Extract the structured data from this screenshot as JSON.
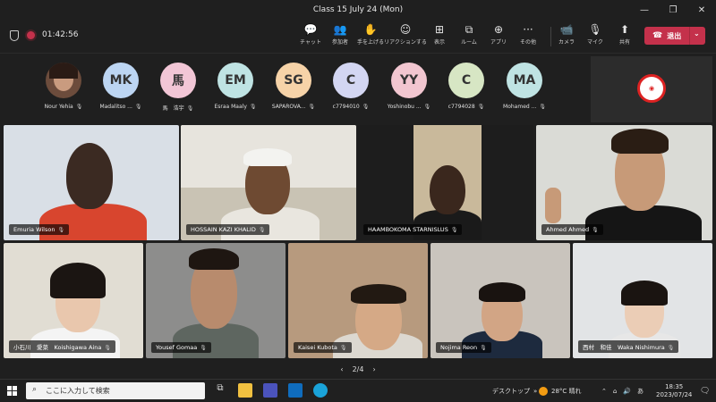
{
  "window": {
    "title": "Class 15 July 24 (Mon)",
    "controls": [
      "—",
      "❐",
      "✕"
    ]
  },
  "meeting": {
    "timer": "01:42:56"
  },
  "toolbar": {
    "buttons": [
      {
        "label": "チャット",
        "icon": "chat-icon",
        "glyph": "💬"
      },
      {
        "label": "参加者",
        "icon": "people-icon",
        "glyph": "👥"
      },
      {
        "label": "手を上げる",
        "icon": "raise-hand-icon",
        "glyph": "✋"
      },
      {
        "label": "リアクションする",
        "icon": "reaction-icon",
        "glyph": "☺"
      },
      {
        "label": "表示",
        "icon": "view-icon",
        "glyph": "⊞"
      },
      {
        "label": "ルーム",
        "icon": "rooms-icon",
        "glyph": "⧉"
      },
      {
        "label": "アプリ",
        "icon": "apps-icon",
        "glyph": "⊕"
      },
      {
        "label": "その他",
        "icon": "more-icon",
        "glyph": "···"
      },
      {
        "label": "カメラ",
        "icon": "camera-icon",
        "glyph": "📹"
      },
      {
        "label": "マイク",
        "icon": "mic-icon",
        "glyph": "🎙"
      },
      {
        "label": "共有",
        "icon": "share-icon",
        "glyph": "⬆"
      }
    ],
    "leave_label": "退出"
  },
  "attendees": [
    {
      "initials": "",
      "name": "Nour Yehia",
      "color": "#7a5a48",
      "photo": true
    },
    {
      "initials": "MK",
      "name": "Madalitso ...",
      "color": "#bcd5f2"
    },
    {
      "initials": "馬",
      "name": "馬　浩宇",
      "color": "#f2c6d6"
    },
    {
      "initials": "EM",
      "name": "Esraa Maaly",
      "color": "#bfe3e3"
    },
    {
      "initials": "SG",
      "name": "SAPAROVA...",
      "color": "#f6d3a8"
    },
    {
      "initials": "C",
      "name": "c7794010",
      "color": "#d3d6f2"
    },
    {
      "initials": "YY",
      "name": "Yoshinobu ...",
      "color": "#f2c6d0"
    },
    {
      "initials": "C",
      "name": "c7794028",
      "color": "#d7e6c4"
    },
    {
      "initials": "MA",
      "name": "Mohamed ...",
      "color": "#bfe3e3"
    }
  ],
  "videos": [
    {
      "name": "Emuria Wilson",
      "bg": "#d9dfe6",
      "skin": "#3b2a22",
      "shirt": "#d8452e",
      "hair": "#1e1511"
    },
    {
      "name": "HOSSAIN KAZI KHALID",
      "bg": "#c9c3b4",
      "skin": "#6e4a32",
      "shirt": "#e9e6df",
      "hair": "#f3f3f0"
    },
    {
      "name": "HAAMBOKOMA STARNISLUS",
      "bg": "#1d1d1d",
      "skin": "#3a271d",
      "shirt": "#1a1a1a",
      "hair": "#1a1410"
    },
    {
      "name": "Ahmed Ahmed",
      "bg": "#dadbd6",
      "skin": "#c79a78",
      "shirt": "#151515",
      "hair": "#2a1d14"
    },
    {
      "name": "小石川　愛菜　Koishigawa Aina",
      "bg": "#e1ddd3",
      "skin": "#e9c7ad",
      "shirt": "#f4f4f4",
      "hair": "#1b1512"
    },
    {
      "name": "Yousef Gomaa",
      "bg": "#8d8d8c",
      "skin": "#b88b6d",
      "shirt": "#5e6660",
      "hair": "#1e1611"
    },
    {
      "name": "Kaisei Kubota",
      "bg": "#b79a7e",
      "skin": "#d5a986",
      "shirt": "#dcd8d0",
      "hair": "#221912"
    },
    {
      "name": "Nojima Reon",
      "bg": "#c9c4bd",
      "skin": "#d2a585",
      "shirt": "#1d2a3e",
      "hair": "#191310"
    },
    {
      "name": "西村　和佳　Waka Nishimura",
      "bg": "#e2e4e6",
      "skin": "#ebcdb6",
      "shirt": "#e7e7e7",
      "hair": "#1a1411"
    }
  ],
  "pager": {
    "label": "2/4",
    "prev": "‹",
    "next": "›"
  },
  "taskbar": {
    "search_placeholder": "ここに入力して検索",
    "desktop_label": "デスクトップ",
    "weather": "28°C  晴れ",
    "ime": "あ",
    "time": "18:35",
    "date": "2023/07/24"
  }
}
